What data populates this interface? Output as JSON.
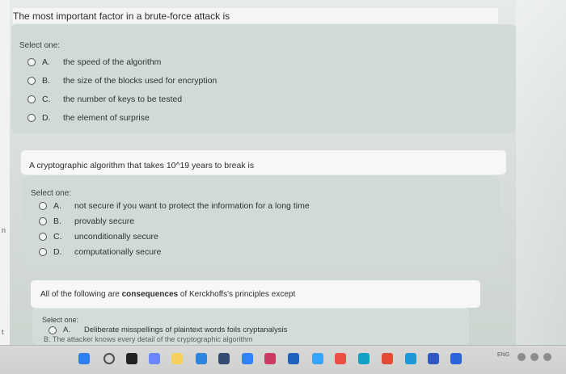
{
  "header": {
    "top_prompt": "The most important factor in a brute-force attack is"
  },
  "quiz": {
    "questions": [
      {
        "select_label": "Select one:",
        "options": [
          {
            "letter": "A.",
            "text": "the speed of the algorithm"
          },
          {
            "letter": "B.",
            "text": "the size of the blocks used for encryption"
          },
          {
            "letter": "C.",
            "text": "the number of keys to be tested"
          },
          {
            "letter": "D.",
            "text": "the element of surprise"
          }
        ]
      },
      {
        "prompt": "A cryptographic algorithm that takes 10^19 years to break is",
        "select_label": "Select one:",
        "options": [
          {
            "letter": "A.",
            "text": "not secure if you want to protect the information for a long time"
          },
          {
            "letter": "B.",
            "text": "provably secure"
          },
          {
            "letter": "C.",
            "text": "unconditionally secure"
          },
          {
            "letter": "D.",
            "text": "computationally secure"
          }
        ]
      },
      {
        "prompt_prefix": "All of the following are ",
        "prompt_bold": "consequences",
        "prompt_suffix": " of Kerckhoffs's principles except",
        "select_label": "Select one:",
        "options": [
          {
            "letter": "A.",
            "text": "Deliberate misspellings of plaintext words foils cryptanalysis"
          },
          {
            "letter": "B.",
            "text": "The attacker knows every detail of the cryptographic algorithm"
          }
        ]
      }
    ]
  },
  "taskbar": {
    "tray_language": "ENG"
  }
}
